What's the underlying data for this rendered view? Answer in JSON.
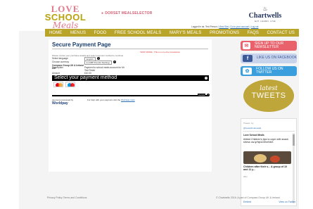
{
  "header": {
    "logo": {
      "line1": "LOVE",
      "line2": "SCHOOL",
      "line3": "Meals"
    },
    "selector": {
      "icon": "location-pin-icon",
      "label": "DORSET MEALSELECTOR"
    },
    "brand": {
      "icon": "chef-hat-icon",
      "name": "Chartwells",
      "tagline": "EAT. LEARN. LIVE"
    },
    "login": {
      "prefix": "Logged in as: Test Person |",
      "links": [
        "View Site",
        "Go to your account",
        "Log out"
      ]
    }
  },
  "nav": {
    "items": [
      "HOME",
      "MENUS",
      "FOOD",
      "FREE SCHOOL MEALS",
      "MARY'S MEALS",
      "PROMOTIONS",
      "FAQS",
      "CONTACT US"
    ],
    "color": "#b9a42a"
  },
  "payment": {
    "title": "Secure Payment Page",
    "test_mode": "TEST MODE - This is not a live transaction",
    "instruction": "Please review your purchase details and select payment method to continue",
    "rows": [
      {
        "label": "Select language",
        "value": "English"
      },
      {
        "label": "Choose currency",
        "value": "£ (GBP Pounds Sterling)"
      },
      {
        "label": "Compass Group UK & Ireland Ltd",
        "value": ""
      },
      {
        "label": "Description",
        "value": "Payment to school meals account for Mr Test Tester"
      },
      {
        "label": "Amount",
        "value": "£10.00"
      }
    ],
    "select_method": "Select your payment method",
    "cards": [
      "mastercard-icon",
      "maestro-icon"
    ],
    "cancel": "Cancel",
    "provider": {
      "tag": "payment processed by",
      "name": "Worldpay"
    },
    "help_text": "For help with your payment visit the",
    "help_link": "Worldpay Help"
  },
  "sidebar": {
    "signup": {
      "icon": "envelope-icon",
      "label": "SIGN UP TO OUR NEWSLETTER",
      "color": "#e9626b"
    },
    "facebook": {
      "icon": "facebook-icon",
      "label": "LIKE US ON FACEBOOK",
      "color": "#c8d4ec"
    },
    "twitter": {
      "icon": "twitter-bird-icon",
      "label": "FOLLOW US ON TWITTER",
      "color": "#3a9fdc"
    },
    "latest": {
      "line1": "latest",
      "line2": "TWEETS"
    },
    "tweets": {
      "heading": "Tweets",
      "by": "by",
      "handle": "@loveschoolmeals",
      "author": "Love School Meals",
      "text": "#Iddot Children's tips to cope with snack stress ow.ly/hlp4J30mNbG",
      "caption": "Children after their s... A group of 10 and 11 y...",
      "date": "26m",
      "embed": "Embed",
      "view": "View on Twitter"
    }
  },
  "footer": {
    "left": "Privacy Policy    Terms and Conditions",
    "right": "© Chartwells 2016. A part of Compass Group UK & Ireland"
  }
}
